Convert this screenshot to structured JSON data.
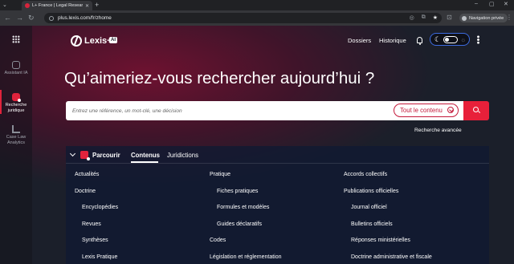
{
  "browser": {
    "tab_title": "L+ France | Legal Research",
    "url": "plus.lexis.com/fr/zhome",
    "private_label": "Navigation privée"
  },
  "sidebar": {
    "items": [
      {
        "label": "Assistant IA",
        "active": false,
        "icon": "assistant-icon"
      },
      {
        "label": "Recherche juridique",
        "active": true,
        "icon": "legal-research-icon"
      },
      {
        "label": "Case Law Analytics",
        "active": false,
        "icon": "analytics-icon"
      }
    ]
  },
  "header": {
    "logo": "Lexis+",
    "logo_badge": "AI",
    "dossiers": "Dossiers",
    "historique": "Historique"
  },
  "main": {
    "headline": "Qu’aimeriez-vous rechercher aujourd’hui ?",
    "search_placeholder": "Entrez une référence, un mot-clé, une décision",
    "scope": "Tout le contenu",
    "advanced_search": "Recherche avancée"
  },
  "browse": {
    "title": "Parcourir",
    "tabs": [
      "Contenus",
      "Juridictions"
    ],
    "active_tab": "Contenus",
    "columns": [
      [
        {
          "label": "Actualités",
          "sub": false
        },
        {
          "label": "Doctrine",
          "sub": false
        },
        {
          "label": "Encyclopédies",
          "sub": true
        },
        {
          "label": "Revues",
          "sub": true
        },
        {
          "label": "Synthèses",
          "sub": true
        },
        {
          "label": "Lexis Pratique",
          "sub": true
        }
      ],
      [
        {
          "label": "Pratique",
          "sub": false
        },
        {
          "label": "Fiches pratiques",
          "sub": true
        },
        {
          "label": "Formules et modèles",
          "sub": true
        },
        {
          "label": "Guides déclaratifs",
          "sub": true
        },
        {
          "label": "Codes",
          "sub": false
        },
        {
          "label": "Législation et réglementation",
          "sub": false
        }
      ],
      [
        {
          "label": "Accords collectifs",
          "sub": false
        },
        {
          "label": "Publications officielles",
          "sub": false
        },
        {
          "label": "Journal officiel",
          "sub": true
        },
        {
          "label": "Bulletins officiels",
          "sub": true
        },
        {
          "label": "Réponses ministérielles",
          "sub": true
        },
        {
          "label": "Doctrine administrative et fiscale",
          "sub": true
        }
      ]
    ]
  },
  "colors": {
    "accent": "#e8203a",
    "background": "#1b1f2a",
    "panel": "#0f1932"
  }
}
